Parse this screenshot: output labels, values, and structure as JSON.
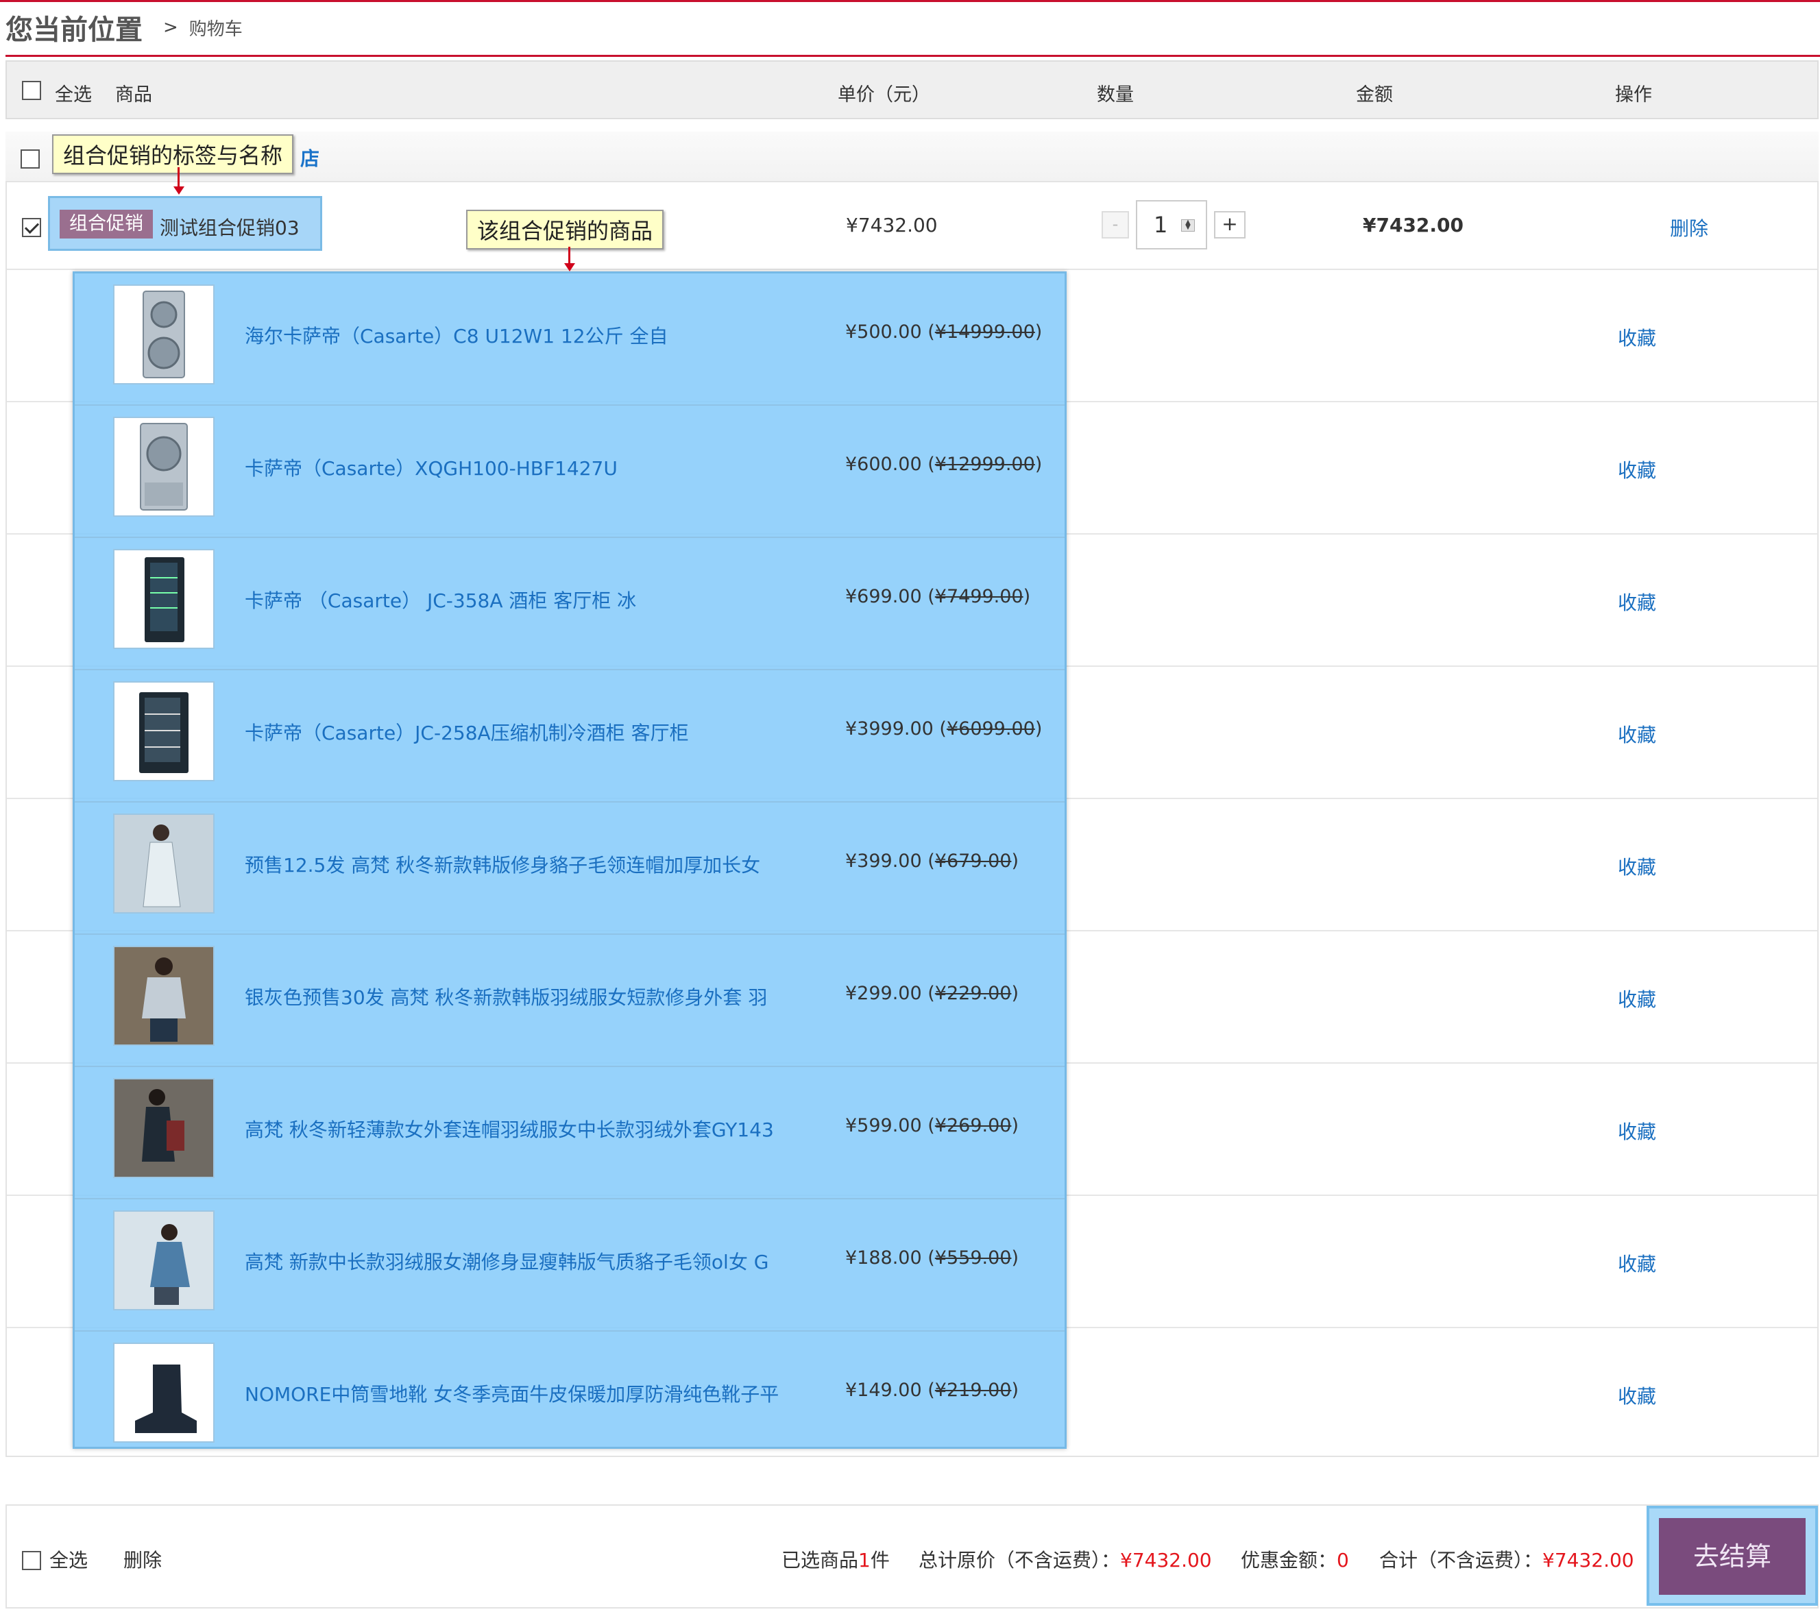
{
  "breadcrumb": {
    "title": "您当前位置",
    "sep": ">",
    "current": "购物车"
  },
  "header": {
    "select_all": "全选",
    "product": "商品",
    "unit_price": "单价（元）",
    "quantity": "数量",
    "amount": "金额",
    "operation": "操作"
  },
  "store": {
    "name_suffix": "店"
  },
  "package": {
    "badge": "组合促销",
    "name": "测试组合促销03",
    "unit_price": "¥7432.00",
    "quantity": "1",
    "minus": "-",
    "plus": "+",
    "total": "¥7432.00",
    "delete": "删除"
  },
  "tips": {
    "label_tip": "组合促销的标签与名称",
    "items_tip": "该组合促销的商品"
  },
  "items": [
    {
      "name": "海尔卡萨帝（Casarte）C8 U12W1 12公斤 全自",
      "price": "¥500.00",
      "orig": "¥14999.00",
      "fav": "收藏"
    },
    {
      "name": "卡萨帝（Casarte）XQGH100-HBF1427U",
      "price": "¥600.00",
      "orig": "¥12999.00",
      "fav": "收藏"
    },
    {
      "name": "卡萨帝 （Casarte） JC-358A 酒柜 客厅柜 冰",
      "price": "¥699.00",
      "orig": "¥7499.00",
      "fav": "收藏"
    },
    {
      "name": "卡萨帝（Casarte）JC-258A压缩机制冷酒柜 客厅柜",
      "price": "¥3999.00",
      "orig": "¥6099.00",
      "fav": "收藏"
    },
    {
      "name": "预售12.5发 高梵 秋冬新款韩版修身貉子毛领连帽加厚加长女",
      "price": "¥399.00",
      "orig": "¥679.00",
      "fav": "收藏"
    },
    {
      "name": "银灰色预售30发 高梵 秋冬新款韩版羽绒服女短款修身外套 羽",
      "price": "¥299.00",
      "orig": "¥229.00",
      "fav": "收藏"
    },
    {
      "name": "高梵 秋冬新轻薄款女外套连帽羽绒服女中长款羽绒外套GY143",
      "price": "¥599.00",
      "orig": "¥269.00",
      "fav": "收藏"
    },
    {
      "name": "高梵 新款中长款羽绒服女潮修身显瘦韩版气质貉子毛领ol女 G",
      "price": "¥188.00",
      "orig": "¥559.00",
      "fav": "收藏"
    },
    {
      "name": "NOMORE中筒雪地靴 女冬季亮面牛皮保暖加厚防滑纯色靴子平",
      "price": "¥149.00",
      "orig": "¥219.00",
      "fav": "收藏"
    }
  ],
  "footer": {
    "select_all": "全选",
    "delete": "删除",
    "selected_prefix": "已选商品",
    "selected_count": "1",
    "selected_suffix": "件",
    "orig_total_label": "总计原价（不含运费）：",
    "orig_total": "¥7432.00",
    "discount_label": "优惠金额：",
    "discount": "0",
    "total_label": "合计（不含运费）：",
    "total": "¥7432.00",
    "checkout": "去结算"
  }
}
